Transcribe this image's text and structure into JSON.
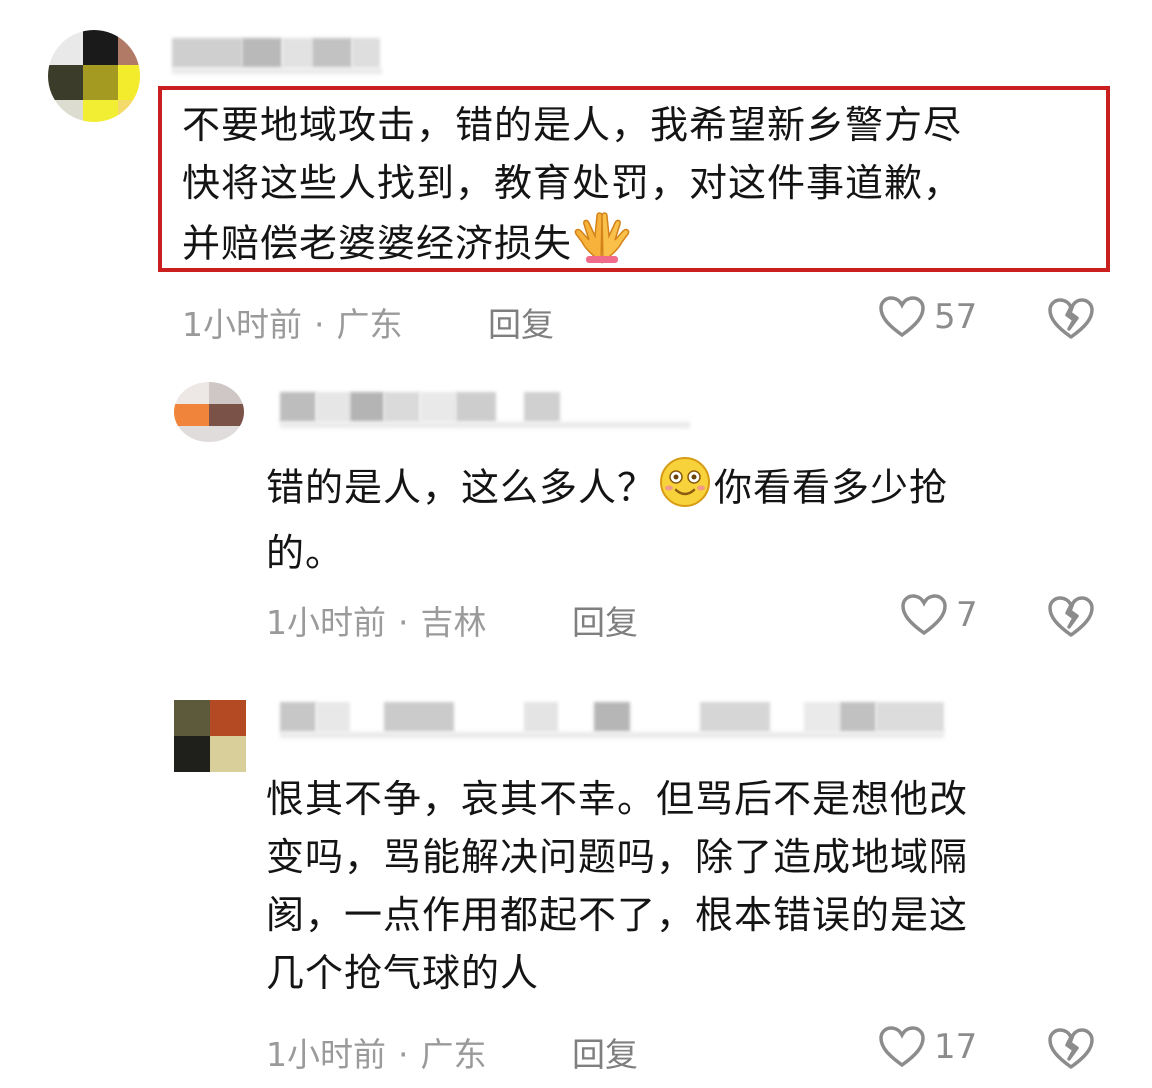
{
  "colors": {
    "highlight_border": "#c9201f",
    "meta_text": "#9a9a9a",
    "body_text": "#141414"
  },
  "comments": [
    {
      "text": "不要地域攻击，错的是人，我希望新乡警方尽\n快将这些人找到，教育处罚，对这件事道歉，\n并赔偿老婆婆经济损失",
      "emoji": "folded-hands-icon",
      "time": "1小时前",
      "location": "广东",
      "reply_label": "回复",
      "likes": "57",
      "highlighted": true
    },
    {
      "text_part1": "错的是人，这么多人？",
      "emoji": "smiling-face-icon",
      "text_part2": "你看看多少抢\n的。",
      "time": "1小时前",
      "location": "吉林",
      "reply_label": "回复",
      "likes": "7"
    },
    {
      "text": "恨其不争，哀其不幸。但骂后不是想他改\n变吗，骂能解决问题吗，除了造成地域隔\n阂，一点作用都起不了，根本错误的是这\n几个抢气球的人",
      "time": "1小时前",
      "location": "广东",
      "reply_label": "回复",
      "likes": "17"
    }
  ],
  "separator": "·"
}
